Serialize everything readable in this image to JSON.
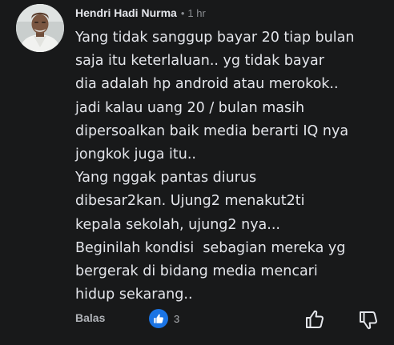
{
  "comment": {
    "author": "Hendri Hadi Nurma",
    "separator": "•",
    "time": "1 hr",
    "lines": [
      "Yang tidak sanggup bayar 20 tiap bulan",
      "saja itu keterlaluan.. yg tidak bayar",
      "dia adalah hp android atau merokok..",
      "jadi kalau uang 20 / bulan masih",
      "dipersoalkan baik media berarti IQ nya",
      "jongkok juga itu..",
      "Yang nggak pantas diurus",
      "dibesar2kan. Ujung2 menakut2ti",
      "kepala sekolah, ujung2 nya...",
      "Beginilah kondisi  sebagian mereka yg",
      "bergerak di bidang media mencari",
      "hidup sekarang.."
    ]
  },
  "actions": {
    "reply_label": "Balas",
    "reaction_count": "3",
    "reaction_icon": "like-icon",
    "upvote_icon": "thumbs-up-outline-icon",
    "downvote_icon": "thumbs-down-outline-icon"
  },
  "colors": {
    "background": "#18191a",
    "text_primary": "#e4e6eb",
    "text_secondary": "#b0b3b8",
    "like_blue": "#1b74e4"
  }
}
